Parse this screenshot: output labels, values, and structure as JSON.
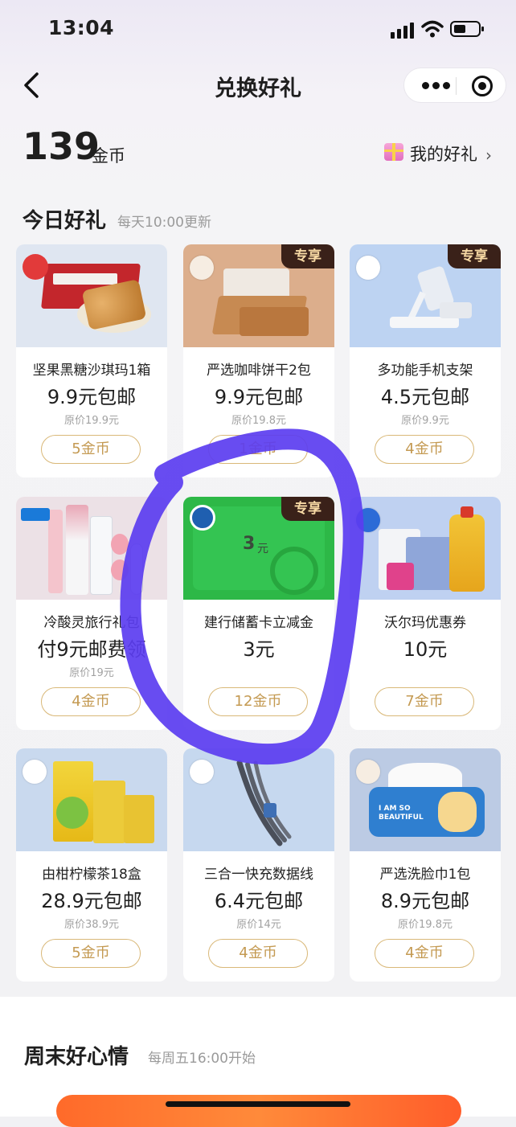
{
  "status_bar": {
    "time": "13:04"
  },
  "nav": {
    "title": "兑换好礼"
  },
  "coins": {
    "amount": "139",
    "unit": "金币"
  },
  "my_gifts": {
    "label": "我的好礼",
    "chevron": "›"
  },
  "today_section": {
    "title": "今日好礼",
    "subtitle": "每天10:00更新"
  },
  "weekend_section": {
    "title": "周末好心情",
    "subtitle": "每周五16:00开始"
  },
  "items": [
    {
      "name": "坚果黑糖沙琪玛1箱",
      "price": "9.9元包邮",
      "original": "原价19.9元",
      "cost": "5金币",
      "badge": "",
      "image": "snack-bar-box"
    },
    {
      "name": "严选咖啡饼干2包",
      "price": "9.9元包邮",
      "original": "原价19.8元",
      "cost": "1金币",
      "badge": "专享",
      "image": "coffee-biscuit"
    },
    {
      "name": "多功能手机支架",
      "price": "4.5元包邮",
      "original": "原价9.9元",
      "cost": "4金币",
      "badge": "专享",
      "image": "phone-stand"
    },
    {
      "name": "冷酸灵旅行礼包",
      "price": "付9元邮费领",
      "original": "原价19元",
      "cost": "4金币",
      "badge": "",
      "image": "toothpaste-kit"
    },
    {
      "name": "建行储蓄卡立减金",
      "price": "3元",
      "original": "",
      "cost": "12金币",
      "badge": "专享",
      "image": "bank-card-coupon",
      "card_text": "3",
      "card_unit": "元"
    },
    {
      "name": "沃尔玛优惠券",
      "price": "10元",
      "original": "",
      "cost": "7金币",
      "badge": "",
      "image": "walmart-goods"
    },
    {
      "name": "由柑柠檬茶18盒",
      "price": "28.9元包邮",
      "original": "原价38.9元",
      "cost": "5金币",
      "badge": "",
      "image": "lemon-tea"
    },
    {
      "name": "三合一快充数据线",
      "price": "6.4元包邮",
      "original": "原价14元",
      "cost": "4金币",
      "badge": "",
      "image": "usb-cable"
    },
    {
      "name": "严选洗脸巾1包",
      "price": "8.9元包邮",
      "original": "原价19.8元",
      "cost": "4金币",
      "badge": "",
      "image": "face-towel",
      "pack_text": "I AM SO BEAUTIFUL"
    }
  ],
  "colors": {
    "badge_bg": "#3a2119",
    "badge_text": "#f7d9a4",
    "button_border": "#d9b878",
    "button_text": "#c49a52",
    "scribble": "#5b3df0"
  }
}
